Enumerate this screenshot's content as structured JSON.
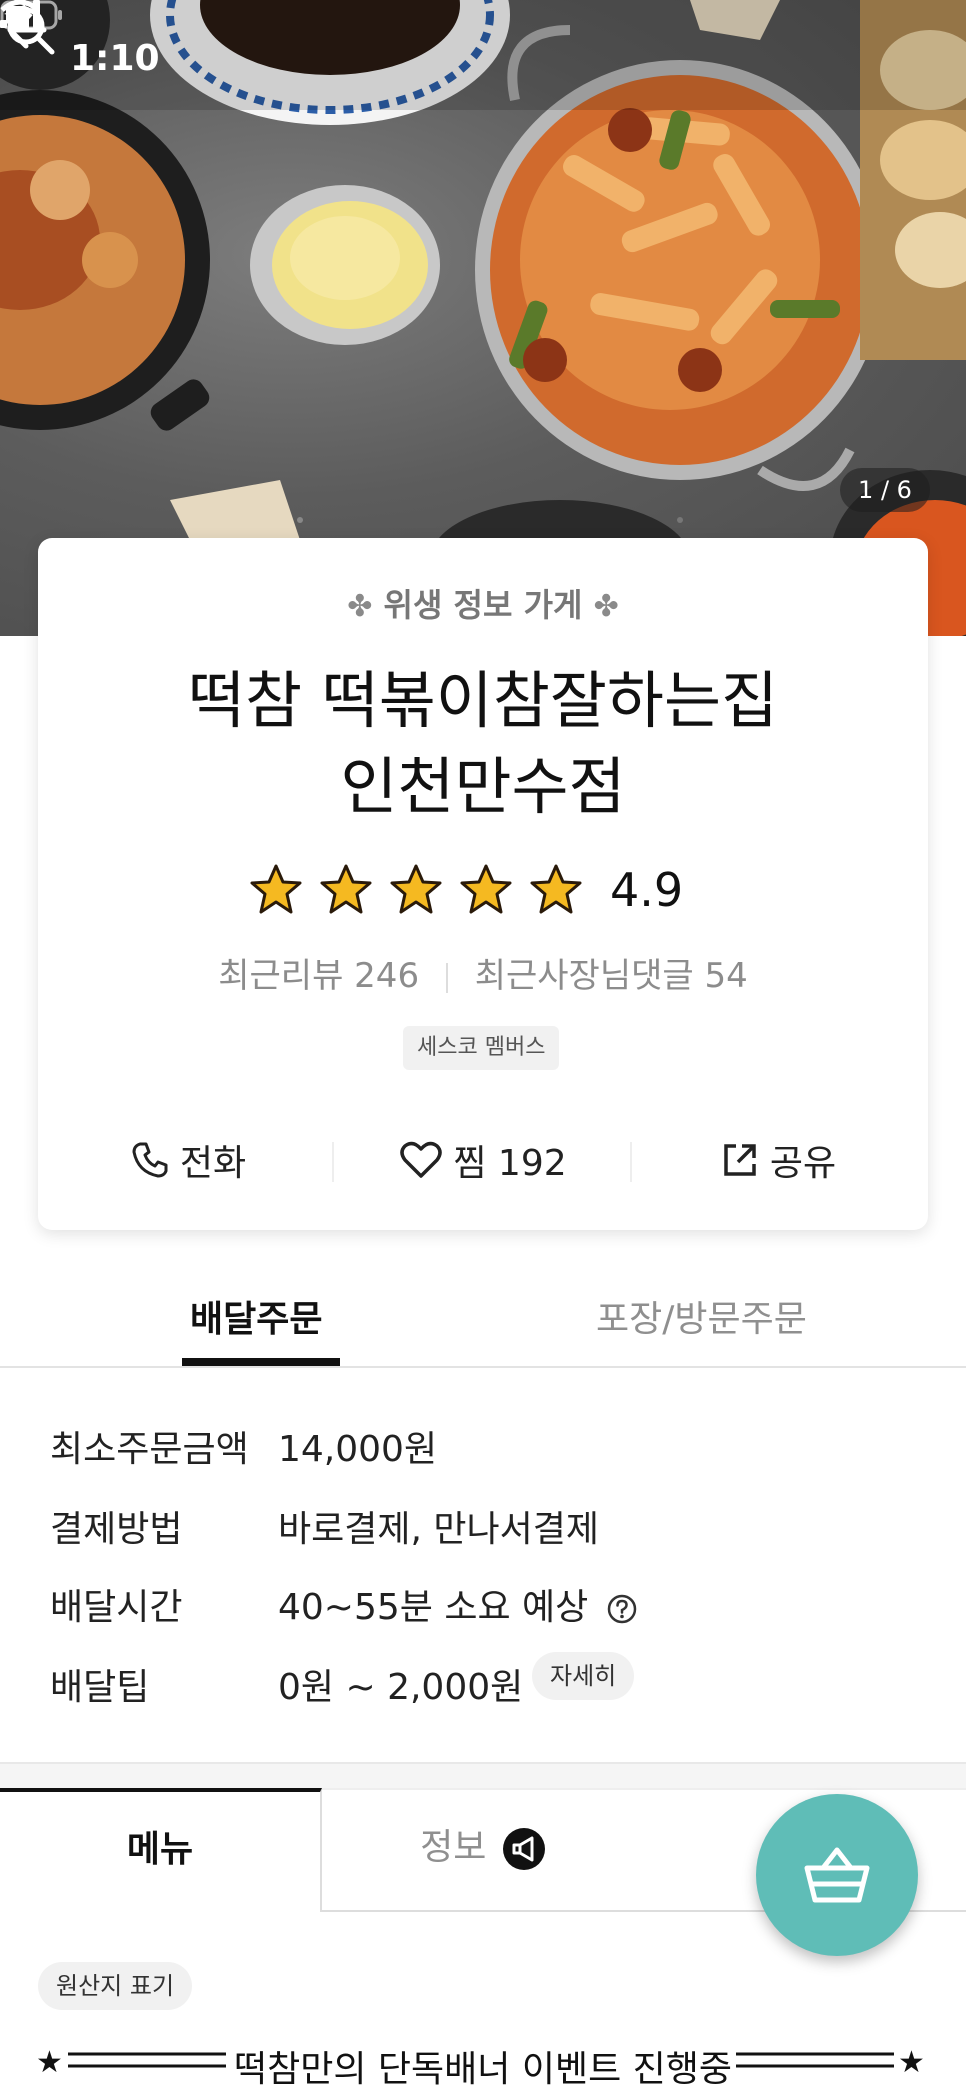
{
  "status_bar": {
    "time": "1:10"
  },
  "hero": {
    "photo_counter": "1 / 6"
  },
  "store": {
    "hygiene_badge": "위생 정보 가게",
    "name_line1": "떡참 떡볶이참잘하는집",
    "name_line2": "인천만수점",
    "rating_value": "4.9",
    "rating_stars": 5,
    "recent_reviews": "최근리뷰 246",
    "owner_replies": "최근사장님댓글 54",
    "member_tag": "세스코 멤버스",
    "actions": {
      "call": "전화",
      "like": "찜 192",
      "share": "공유"
    }
  },
  "order_tabs": {
    "delivery": "배달주문",
    "pickup": "포장/방문주문"
  },
  "info": {
    "min_order_label": "최소주문금액",
    "min_order_value": "14,000원",
    "payment_label": "결제방법",
    "payment_value": "바로결제, 만나서결제",
    "delivery_time_label": "배달시간",
    "delivery_time_value": "40~55분 소요 예상",
    "delivery_tip_label": "배달팁",
    "delivery_tip_value": "0원 ~ 2,000원",
    "detail_button": "자세히"
  },
  "menu_tabs": {
    "menu": "메뉴",
    "info": "정보"
  },
  "origin_chip": "원산지 표기",
  "event_banner": "떡참만의 단독배너 이벤트 진행중",
  "colors": {
    "accent": "#5fbdb7",
    "star": "#f5b921"
  }
}
